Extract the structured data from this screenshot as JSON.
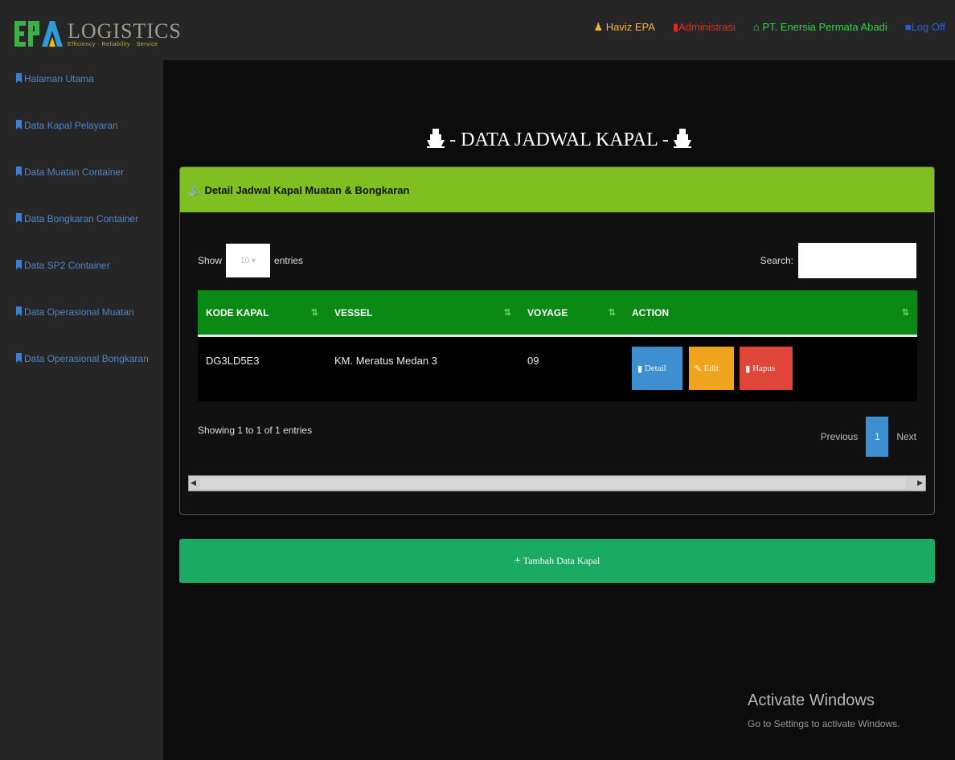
{
  "brand": {
    "name": "LOGISTICS",
    "tagline": "Efficiency · Reliability · Service"
  },
  "topnav": {
    "user": "Haviz EPA",
    "role": "Administrasi",
    "company": "PT. Enersia Permata Abadi",
    "logout": "Log Off"
  },
  "sidebar": {
    "items": [
      {
        "label": "Halaman Utama"
      },
      {
        "label": "Data Kapal Pelayaran"
      },
      {
        "label": "Data Muatan Container"
      },
      {
        "label": "Data Bongkaran Container"
      },
      {
        "label": "Data SP2 Container"
      },
      {
        "label": "Data Operasional Muatan"
      },
      {
        "label": "Data Operasional Bongkaran"
      }
    ]
  },
  "page": {
    "title": "- DATA JADWAL KAPAL -"
  },
  "panel": {
    "title": "Detail Jadwal Kapal Muatan & Bongkaran",
    "show_label": "Show",
    "entries_value": "10",
    "entries_label": "entries",
    "search_label": "Search:",
    "search_value": ""
  },
  "table": {
    "headers": [
      "KODE KAPAL",
      "VESSEL",
      "VOYAGE",
      "ACTION"
    ],
    "rows": [
      {
        "kode": "DG3LD5E3",
        "vessel": "KM. Meratus Medan 3",
        "voyage": "09",
        "actions": [
          "Detail",
          "Edit",
          "Hapus"
        ]
      }
    ],
    "info": "Showing 1 to 1 of 1 entries",
    "pager": {
      "previous": "Previous",
      "current": "1",
      "next": "Next"
    }
  },
  "add_button": "Tambah Data Kapal",
  "watermark": {
    "title": "Activate Windows",
    "subtitle": "Go to Settings to activate Windows."
  },
  "colors": {
    "panel_header": "#7fbf1f",
    "table_header": "#0a8a14",
    "add_button": "#1aaa63",
    "detail": "#3d8fd0",
    "edit": "#f0a31d",
    "hapus": "#e0453a"
  }
}
